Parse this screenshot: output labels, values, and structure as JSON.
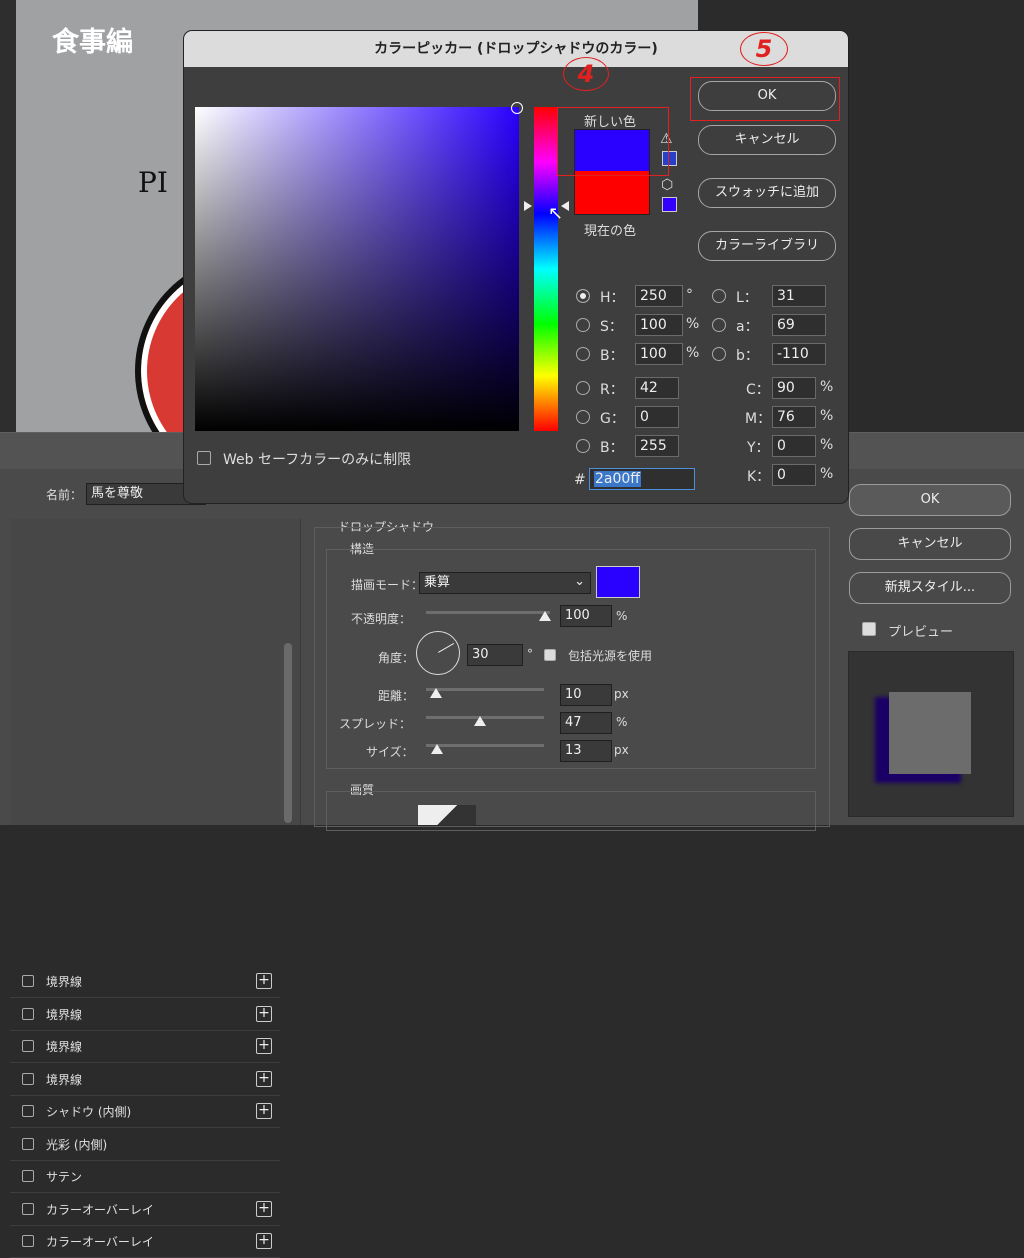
{
  "canvas": {
    "title": "食事編",
    "text": "PI"
  },
  "layer_style": {
    "name_label": "名前：",
    "name_value": "馬を尊敬",
    "styles": [
      {
        "label": "境界線",
        "checked": false,
        "plus": true
      },
      {
        "label": "境界線",
        "checked": false,
        "plus": true
      },
      {
        "label": "境界線",
        "checked": false,
        "plus": true
      },
      {
        "label": "境界線",
        "checked": false,
        "plus": true
      },
      {
        "label": "シャドウ (内側)",
        "checked": false,
        "plus": true
      },
      {
        "label": "光彩 (内側)",
        "checked": false,
        "plus": false
      },
      {
        "label": "サテン",
        "checked": false,
        "plus": false
      },
      {
        "label": "カラーオーバーレイ",
        "checked": false,
        "plus": true
      },
      {
        "label": "カラーオーバーレイ",
        "checked": false,
        "plus": true
      }
    ],
    "section_title": "ドロップシャドウ",
    "structure_title": "構造",
    "blend_label": "描画モード：",
    "blend_value": "乗算",
    "shadow_color": "#2a00ff",
    "opacity_label": "不透明度：",
    "opacity_value": "100",
    "angle_label": "角度：",
    "angle_value": "30",
    "global_light_label": "包括光源を使用",
    "distance_label": "距離：",
    "distance_value": "10",
    "spread_label": "スプレッド：",
    "spread_value": "47",
    "size_label": "サイズ：",
    "size_value": "13",
    "unit_percent": "%",
    "unit_px": "px",
    "unit_degree": "°",
    "quality_title": "画質",
    "ok_label": "OK",
    "cancel_label": "キャンセル",
    "new_style_label": "新規スタイル...",
    "preview_label": "プレビュー"
  },
  "picker": {
    "title": "カラーピッカー (ドロップシャドウのカラー)",
    "new_color_label": "新しい色",
    "current_color_label": "現在の色",
    "new_color": "#2a00ff",
    "current_color": "#ff0000",
    "ok_label": "OK",
    "cancel_label": "キャンセル",
    "add_swatch_label": "スウォッチに追加",
    "library_label": "カラーライブラリ",
    "web_safe_label": "Web セーフカラーのみに制限",
    "H": {
      "label": "H：",
      "value": "250",
      "unit": "°"
    },
    "S": {
      "label": "S：",
      "value": "100",
      "unit": "%"
    },
    "Bv": {
      "label": "B：",
      "value": "100",
      "unit": "%"
    },
    "R": {
      "label": "R：",
      "value": "42"
    },
    "G": {
      "label": "G：",
      "value": "0"
    },
    "Bl": {
      "label": "B：",
      "value": "255"
    },
    "L": {
      "label": "L：",
      "value": "31"
    },
    "a": {
      "label": "a：",
      "value": "69"
    },
    "b": {
      "label": "b：",
      "value": "-110"
    },
    "C": {
      "label": "C：",
      "value": "90",
      "unit": "%"
    },
    "M": {
      "label": "M：",
      "value": "76",
      "unit": "%"
    },
    "Y": {
      "label": "Y：",
      "value": "0",
      "unit": "%"
    },
    "K": {
      "label": "K：",
      "value": "0",
      "unit": "%"
    },
    "hash": "#",
    "hex": "2a00ff"
  },
  "annotations": {
    "step4": "4",
    "step5": "5"
  }
}
